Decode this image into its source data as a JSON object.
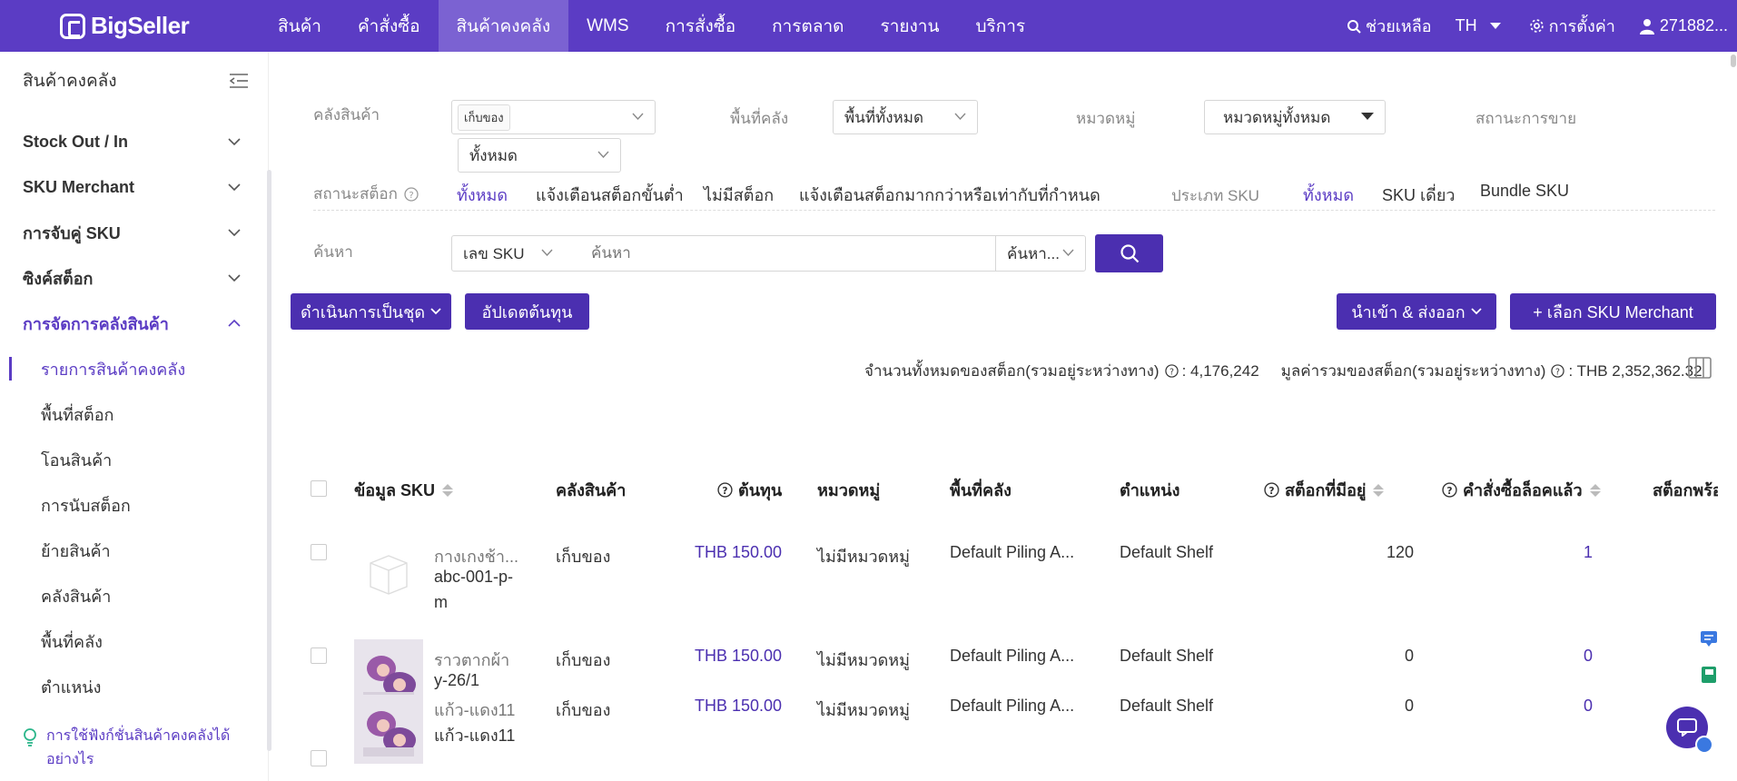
{
  "topbar": {
    "brand": "BigSeller",
    "nav": [
      "สินค้า",
      "คำสั่งซื้อ",
      "สินค้าคงคลัง",
      "WMS",
      "การสั่งซื้อ",
      "การตลาด",
      "รายงาน",
      "บริการ"
    ],
    "help": "ช่วยเหลือ",
    "lang": "TH",
    "settings": "การตั้งค่า",
    "user": "271882..."
  },
  "sidebar": {
    "title": "สินค้าคงคลัง",
    "groups": [
      "Stock Out / In",
      "SKU Merchant",
      "การจับคู่ SKU",
      "ซิงค์สต็อก",
      "การจัดการคลังสินค้า"
    ],
    "items": [
      "รายการสินค้าคงคลัง",
      "พื้นที่สต็อก",
      "โอนสินค้า",
      "การนับสต็อก",
      "ย้ายสินค้า",
      "คลังสินค้า",
      "พื้นที่คลัง",
      "ตำแหน่ง"
    ],
    "tip": "การใช้ฟังก์ชั่นสินค้าคงคลังได้อย่างไร"
  },
  "filters": {
    "warehouse_label": "คลังสินค้า",
    "warehouse_tag": "เก็บของ",
    "warehouse_extra": "ทั้งหมด",
    "area_label": "พื้นที่คลัง",
    "area_value": "พื้นที่ทั้งหมด",
    "category_label": "หมวดหมู่",
    "category_value": "หมวดหมู่ทั้งหมด",
    "sales_status_label": "สถานะการขาย",
    "stock_status_label": "สถานะสต็อก",
    "stock_status_options": [
      "ทั้งหมด",
      "แจ้งเตือนสต็อกขั้นต่ำ",
      "ไม่มีสต็อก",
      "แจ้งเตือนสต็อกมากกว่าหรือเท่ากับที่กำหนด"
    ],
    "sku_type_label": "ประเภท SKU",
    "sku_type_options": [
      "ทั้งหมด",
      "SKU เดี่ยว",
      "Bundle SKU"
    ],
    "search_label": "ค้นหา",
    "search_field": "เลข SKU",
    "search_placeholder": "ค้นหา",
    "search_mode": "ค้นหา..."
  },
  "actions": {
    "bulk": "ดำเนินการเป็นชุด",
    "update_cost": "อัปเดตต้นทุน",
    "import_export": "นำเข้า & ส่งออก",
    "add_sku": "+ เลือก SKU Merchant"
  },
  "summary": {
    "total_qty_label": "จำนวนทั้งหมดของสต็อก(รวมอยู่ระหว่างทาง)",
    "total_qty_value": ": 4,176,242",
    "total_value_label": "มูลค่ารวมของสต็อก(รวมอยู่ระหว่างทาง)",
    "total_value_value": ": THB 2,352,362.32"
  },
  "table": {
    "headers": [
      "ข้อมูล SKU",
      "คลังสินค้า",
      "ต้นทุน",
      "หมวดหมู่",
      "พื้นที่คลัง",
      "ตำแหน่ง",
      "สต็อกที่มีอยู่",
      "คำสั่งซื้อล็อคแล้ว",
      "สต็อกพร้อม"
    ],
    "rows": [
      {
        "name": "กางเกงช้า...",
        "sku1": "abc-001-p-",
        "sku2": "m",
        "warehouse": "เก็บของ",
        "cost": "THB 150.00",
        "category": "ไม่มีหมวดหมู่",
        "area": "Default Piling A...",
        "shelf": "Default Shelf",
        "stock": "120",
        "locked": "1"
      },
      {
        "name": "ราวตากผ้า",
        "sku1": "y-26/1",
        "sku2": "",
        "warehouse": "เก็บของ",
        "cost": "THB 150.00",
        "category": "ไม่มีหมวดหมู่",
        "area": "Default Piling A...",
        "shelf": "Default Shelf",
        "stock": "0",
        "locked": "0"
      },
      {
        "name": "แก้ว-แดง11",
        "sku1": "แก้ว-แดง11",
        "sku2": "",
        "warehouse": "เก็บของ",
        "cost": "THB 150.00",
        "category": "ไม่มีหมวดหมู่",
        "area": "Default Piling A...",
        "shelf": "Default Shelf",
        "stock": "0",
        "locked": "0"
      }
    ]
  },
  "colors": {
    "brand": "#5b3cc4",
    "brand_dark": "#4b2fb0",
    "link": "#4b2fb0"
  }
}
